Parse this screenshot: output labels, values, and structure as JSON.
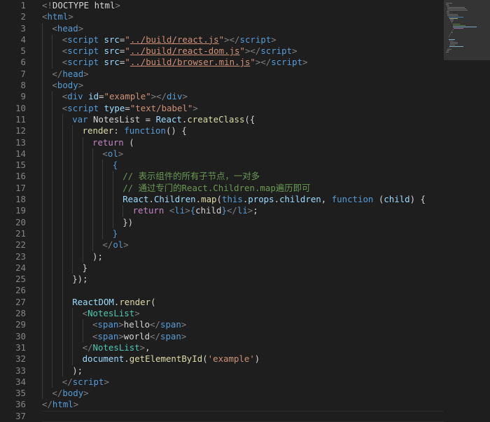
{
  "editor": {
    "line_numbers": [
      "1",
      "2",
      "3",
      "4",
      "5",
      "6",
      "7",
      "8",
      "9",
      "10",
      "11",
      "12",
      "13",
      "14",
      "15",
      "16",
      "17",
      "18",
      "19",
      "20",
      "21",
      "22",
      "23",
      "24",
      "25",
      "26",
      "27",
      "28",
      "29",
      "30",
      "31",
      "32",
      "33",
      "34",
      "35",
      "36",
      "37"
    ],
    "current_line": "37",
    "lines": [
      {
        "indent": 0,
        "tokens": [
          {
            "c": "t-punc",
            "t": "<!"
          },
          {
            "c": "t-text",
            "t": "DOCTYPE html"
          },
          {
            "c": "t-punc",
            "t": ">"
          }
        ]
      },
      {
        "indent": 0,
        "tokens": [
          {
            "c": "t-punc",
            "t": "<"
          },
          {
            "c": "t-tag",
            "t": "html"
          },
          {
            "c": "t-punc",
            "t": ">"
          }
        ]
      },
      {
        "indent": 1,
        "tokens": [
          {
            "c": "t-punc",
            "t": "<"
          },
          {
            "c": "t-tag",
            "t": "head"
          },
          {
            "c": "t-punc",
            "t": ">"
          }
        ]
      },
      {
        "indent": 2,
        "tokens": [
          {
            "c": "t-punc",
            "t": "<"
          },
          {
            "c": "t-tag",
            "t": "script"
          },
          {
            "c": "t-text",
            "t": " "
          },
          {
            "c": "t-attr",
            "t": "src"
          },
          {
            "c": "t-text",
            "t": "="
          },
          {
            "c": "t-str",
            "t": "\""
          },
          {
            "c": "t-link",
            "t": "../build/react.js"
          },
          {
            "c": "t-str",
            "t": "\""
          },
          {
            "c": "t-punc",
            "t": "></"
          },
          {
            "c": "t-tag",
            "t": "script"
          },
          {
            "c": "t-punc",
            "t": ">"
          }
        ]
      },
      {
        "indent": 2,
        "tokens": [
          {
            "c": "t-punc",
            "t": "<"
          },
          {
            "c": "t-tag",
            "t": "script"
          },
          {
            "c": "t-text",
            "t": " "
          },
          {
            "c": "t-attr",
            "t": "src"
          },
          {
            "c": "t-text",
            "t": "="
          },
          {
            "c": "t-str",
            "t": "\""
          },
          {
            "c": "t-link",
            "t": "../build/react-dom.js"
          },
          {
            "c": "t-str",
            "t": "\""
          },
          {
            "c": "t-punc",
            "t": "></"
          },
          {
            "c": "t-tag",
            "t": "script"
          },
          {
            "c": "t-punc",
            "t": ">"
          }
        ]
      },
      {
        "indent": 2,
        "tokens": [
          {
            "c": "t-punc",
            "t": "<"
          },
          {
            "c": "t-tag",
            "t": "script"
          },
          {
            "c": "t-text",
            "t": " "
          },
          {
            "c": "t-attr",
            "t": "src"
          },
          {
            "c": "t-text",
            "t": "="
          },
          {
            "c": "t-str",
            "t": "\""
          },
          {
            "c": "t-link",
            "t": "../build/browser.min.js"
          },
          {
            "c": "t-str",
            "t": "\""
          },
          {
            "c": "t-punc",
            "t": "></"
          },
          {
            "c": "t-tag",
            "t": "script"
          },
          {
            "c": "t-punc",
            "t": ">"
          }
        ]
      },
      {
        "indent": 1,
        "tokens": [
          {
            "c": "t-punc",
            "t": "</"
          },
          {
            "c": "t-tag",
            "t": "head"
          },
          {
            "c": "t-punc",
            "t": ">"
          }
        ]
      },
      {
        "indent": 1,
        "tokens": [
          {
            "c": "t-punc",
            "t": "<"
          },
          {
            "c": "t-tag",
            "t": "body"
          },
          {
            "c": "t-punc",
            "t": ">"
          }
        ]
      },
      {
        "indent": 2,
        "tokens": [
          {
            "c": "t-punc",
            "t": "<"
          },
          {
            "c": "t-tag",
            "t": "div"
          },
          {
            "c": "t-text",
            "t": " "
          },
          {
            "c": "t-attr",
            "t": "id"
          },
          {
            "c": "t-text",
            "t": "="
          },
          {
            "c": "t-str",
            "t": "\"example\""
          },
          {
            "c": "t-punc",
            "t": "></"
          },
          {
            "c": "t-tag",
            "t": "div"
          },
          {
            "c": "t-punc",
            "t": ">"
          }
        ]
      },
      {
        "indent": 2,
        "tokens": [
          {
            "c": "t-punc",
            "t": "<"
          },
          {
            "c": "t-tag",
            "t": "script"
          },
          {
            "c": "t-text",
            "t": " "
          },
          {
            "c": "t-attr",
            "t": "type"
          },
          {
            "c": "t-text",
            "t": "="
          },
          {
            "c": "t-str",
            "t": "\"text/babel\""
          },
          {
            "c": "t-punc",
            "t": ">"
          }
        ]
      },
      {
        "indent": 3,
        "tokens": [
          {
            "c": "t-storage",
            "t": "var"
          },
          {
            "c": "t-text",
            "t": " NotesList = "
          },
          {
            "c": "t-obj",
            "t": "React"
          },
          {
            "c": "t-text",
            "t": "."
          },
          {
            "c": "t-fn",
            "t": "createClass"
          },
          {
            "c": "t-text",
            "t": "({"
          }
        ]
      },
      {
        "indent": 4,
        "tokens": [
          {
            "c": "t-fn",
            "t": "render"
          },
          {
            "c": "t-text",
            "t": ": "
          },
          {
            "c": "t-storage",
            "t": "function"
          },
          {
            "c": "t-text",
            "t": "() {"
          }
        ]
      },
      {
        "indent": 5,
        "tokens": [
          {
            "c": "t-kw",
            "t": "return"
          },
          {
            "c": "t-text",
            "t": " ("
          }
        ]
      },
      {
        "indent": 6,
        "tokens": [
          {
            "c": "t-punc",
            "t": "<"
          },
          {
            "c": "t-tag",
            "t": "ol"
          },
          {
            "c": "t-punc",
            "t": ">"
          }
        ]
      },
      {
        "indent": 7,
        "tokens": [
          {
            "c": "t-tag",
            "t": "{"
          }
        ]
      },
      {
        "indent": 8,
        "tokens": [
          {
            "c": "t-comment",
            "t": "// 表示组件的所有子节点，一对多"
          }
        ]
      },
      {
        "indent": 8,
        "tokens": [
          {
            "c": "t-comment",
            "t": "// 通过专门的React.Children.map遍历即可"
          }
        ]
      },
      {
        "indent": 8,
        "tokens": [
          {
            "c": "t-obj",
            "t": "React"
          },
          {
            "c": "t-text",
            "t": "."
          },
          {
            "c": "t-obj",
            "t": "Children"
          },
          {
            "c": "t-text",
            "t": "."
          },
          {
            "c": "t-fn",
            "t": "map"
          },
          {
            "c": "t-text",
            "t": "("
          },
          {
            "c": "t-storage",
            "t": "this"
          },
          {
            "c": "t-text",
            "t": "."
          },
          {
            "c": "t-prop",
            "t": "props"
          },
          {
            "c": "t-text",
            "t": "."
          },
          {
            "c": "t-prop",
            "t": "children"
          },
          {
            "c": "t-text",
            "t": ", "
          },
          {
            "c": "t-storage",
            "t": "function"
          },
          {
            "c": "t-text",
            "t": " ("
          },
          {
            "c": "t-attr",
            "t": "child"
          },
          {
            "c": "t-text",
            "t": ") {"
          }
        ]
      },
      {
        "indent": 9,
        "tokens": [
          {
            "c": "t-kw",
            "t": "return"
          },
          {
            "c": "t-text",
            "t": " "
          },
          {
            "c": "t-punc",
            "t": "<"
          },
          {
            "c": "t-tag",
            "t": "li"
          },
          {
            "c": "t-punc",
            "t": ">"
          },
          {
            "c": "t-tag",
            "t": "{"
          },
          {
            "c": "t-text",
            "t": "child"
          },
          {
            "c": "t-tag",
            "t": "}"
          },
          {
            "c": "t-punc",
            "t": "</"
          },
          {
            "c": "t-tag",
            "t": "li"
          },
          {
            "c": "t-punc",
            "t": ">"
          },
          {
            "c": "t-text",
            "t": ";"
          }
        ]
      },
      {
        "indent": 8,
        "tokens": [
          {
            "c": "t-text",
            "t": "})"
          }
        ]
      },
      {
        "indent": 7,
        "tokens": [
          {
            "c": "t-tag",
            "t": "}"
          }
        ]
      },
      {
        "indent": 6,
        "tokens": [
          {
            "c": "t-punc",
            "t": "</"
          },
          {
            "c": "t-tag",
            "t": "ol"
          },
          {
            "c": "t-punc",
            "t": ">"
          }
        ]
      },
      {
        "indent": 5,
        "tokens": [
          {
            "c": "t-text",
            "t": ");"
          }
        ]
      },
      {
        "indent": 4,
        "tokens": [
          {
            "c": "t-text",
            "t": "}"
          }
        ]
      },
      {
        "indent": 3,
        "tokens": [
          {
            "c": "t-text",
            "t": "});"
          }
        ]
      },
      {
        "indent": 3,
        "tokens": []
      },
      {
        "indent": 3,
        "tokens": [
          {
            "c": "t-obj",
            "t": "ReactDOM"
          },
          {
            "c": "t-text",
            "t": "."
          },
          {
            "c": "t-fn",
            "t": "render"
          },
          {
            "c": "t-text",
            "t": "("
          }
        ]
      },
      {
        "indent": 4,
        "tokens": [
          {
            "c": "t-punc",
            "t": "<"
          },
          {
            "c": "t-jsx",
            "t": "NotesList"
          },
          {
            "c": "t-punc",
            "t": ">"
          }
        ]
      },
      {
        "indent": 5,
        "tokens": [
          {
            "c": "t-punc",
            "t": "<"
          },
          {
            "c": "t-tag",
            "t": "span"
          },
          {
            "c": "t-punc",
            "t": ">"
          },
          {
            "c": "t-text",
            "t": "hello"
          },
          {
            "c": "t-punc",
            "t": "</"
          },
          {
            "c": "t-tag",
            "t": "span"
          },
          {
            "c": "t-punc",
            "t": ">"
          }
        ]
      },
      {
        "indent": 5,
        "tokens": [
          {
            "c": "t-punc",
            "t": "<"
          },
          {
            "c": "t-tag",
            "t": "span"
          },
          {
            "c": "t-punc",
            "t": ">"
          },
          {
            "c": "t-text",
            "t": "world"
          },
          {
            "c": "t-punc",
            "t": "</"
          },
          {
            "c": "t-tag",
            "t": "span"
          },
          {
            "c": "t-punc",
            "t": ">"
          }
        ]
      },
      {
        "indent": 4,
        "tokens": [
          {
            "c": "t-punc",
            "t": "</"
          },
          {
            "c": "t-jsx",
            "t": "NotesList"
          },
          {
            "c": "t-punc",
            "t": ">"
          },
          {
            "c": "t-text",
            "t": ","
          }
        ]
      },
      {
        "indent": 4,
        "tokens": [
          {
            "c": "t-obj",
            "t": "document"
          },
          {
            "c": "t-text",
            "t": "."
          },
          {
            "c": "t-fn",
            "t": "getElementById"
          },
          {
            "c": "t-text",
            "t": "("
          },
          {
            "c": "t-str",
            "t": "'example'"
          },
          {
            "c": "t-text",
            "t": ")"
          }
        ]
      },
      {
        "indent": 3,
        "tokens": [
          {
            "c": "t-text",
            "t": ");"
          }
        ]
      },
      {
        "indent": 2,
        "tokens": [
          {
            "c": "t-punc",
            "t": "</"
          },
          {
            "c": "t-tag",
            "t": "script"
          },
          {
            "c": "t-punc",
            "t": ">"
          }
        ]
      },
      {
        "indent": 1,
        "tokens": [
          {
            "c": "t-punc",
            "t": "</"
          },
          {
            "c": "t-tag",
            "t": "body"
          },
          {
            "c": "t-punc",
            "t": ">"
          }
        ]
      },
      {
        "indent": 0,
        "tokens": [
          {
            "c": "t-punc",
            "t": "</"
          },
          {
            "c": "t-tag",
            "t": "html"
          },
          {
            "c": "t-punc",
            "t": ">"
          }
        ]
      },
      {
        "indent": 0,
        "tokens": []
      }
    ]
  },
  "theme": {
    "background": "#1e1e1e",
    "line_number": "#858585",
    "tag": "#569cd6",
    "string": "#ce9178",
    "attribute": "#9cdcfe",
    "function": "#dcdcaa",
    "keyword": "#c586c0",
    "comment": "#6a9955",
    "jsx_component": "#4ec9b0"
  }
}
